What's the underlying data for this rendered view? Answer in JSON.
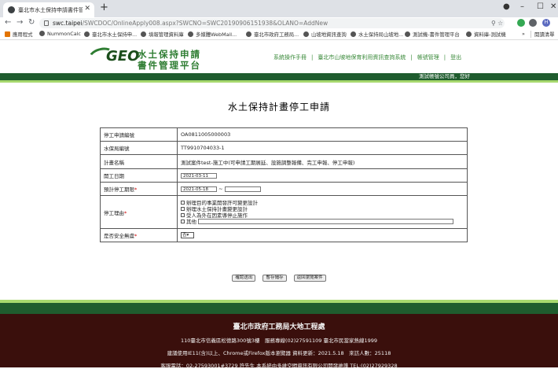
{
  "browser": {
    "tab_title": "臺北市水土保持申請書件管理平台",
    "tab_close": "✕",
    "new_tab": "+",
    "url_host": "swc.taipei",
    "url_path": "/SWCDOC/OnlineApply008.aspx?SWCNO=SWC20190906151938&OLANO=AddNew",
    "profile_initial": "H",
    "bookmarks": [
      "應用程式",
      "NummonCalc",
      "臺北市水土保持申...",
      "填報管理資料庫",
      "多媒體WebMail...",
      "臺北市政府工務局...",
      "山坡地資訊查詢",
      "水土保持局山坡地...",
      "測試機-書件管理平台",
      "資料庫-測試機"
    ],
    "more_bookmarks": "»",
    "reading_list": "閱讀清單"
  },
  "header": {
    "logo_word": "GEO",
    "logo_line1": "水土保持申請",
    "logo_line2": "書件管理平台",
    "links": [
      "系統操作手冊",
      "臺北市山坡地保育利用資訊查詢系統",
      "帳號管理",
      "登出"
    ],
    "separator": "|"
  },
  "userbar": {
    "greeting": "測試帳號公司員，您好"
  },
  "form": {
    "title": "水土保持計畫停工申請",
    "rows": {
      "apply_no": {
        "label": "停工申請編號",
        "value": "OA0811005000003"
      },
      "plan_no": {
        "label": "水保局編號",
        "value": "TT9910704033-1"
      },
      "plan_name": {
        "label": "計畫名稱",
        "value": "測試案件test-施工中(可申請工期展延、設施調整報備、完工申報、停工申報)"
      },
      "start_date": {
        "label": "開工日期",
        "value": "2021-03-11"
      },
      "stop_period": {
        "label": "預計停工期限",
        "required": "*",
        "from": "2021-05-18",
        "tilde": "~",
        "to": ""
      },
      "reasons": {
        "label": "停工理由",
        "required": "*",
        "options": [
          "辦理目的事業開發許可變更設計",
          "辦理水土保持計畫變更設計",
          "受人為外在因素導停止施作"
        ],
        "other_label": "其他",
        "other_value": ""
      },
      "safety": {
        "label": "是否安全無虞",
        "required": "*",
        "selected": "否"
      }
    }
  },
  "buttons": {
    "submit": "確認送出",
    "save": "暫存儲存",
    "back": "返回瀏覽案件"
  },
  "footer": {
    "org": "臺北市政府工務局大地工程處",
    "line1": "110臺北市信義區松德路300號3樓　服務專線(02)27591109 臺北市民當家熱線1999",
    "line2": "建議使用IE11(含)以上、Chrome或Firefox版本瀏覽器 資料更新：2021.5.18　來訪人數：25118",
    "line3": "客服電話：02-27593001#3729 許先生 本系統由多維空間資訊有限公司開發維護 TEL:(02)27929328"
  }
}
